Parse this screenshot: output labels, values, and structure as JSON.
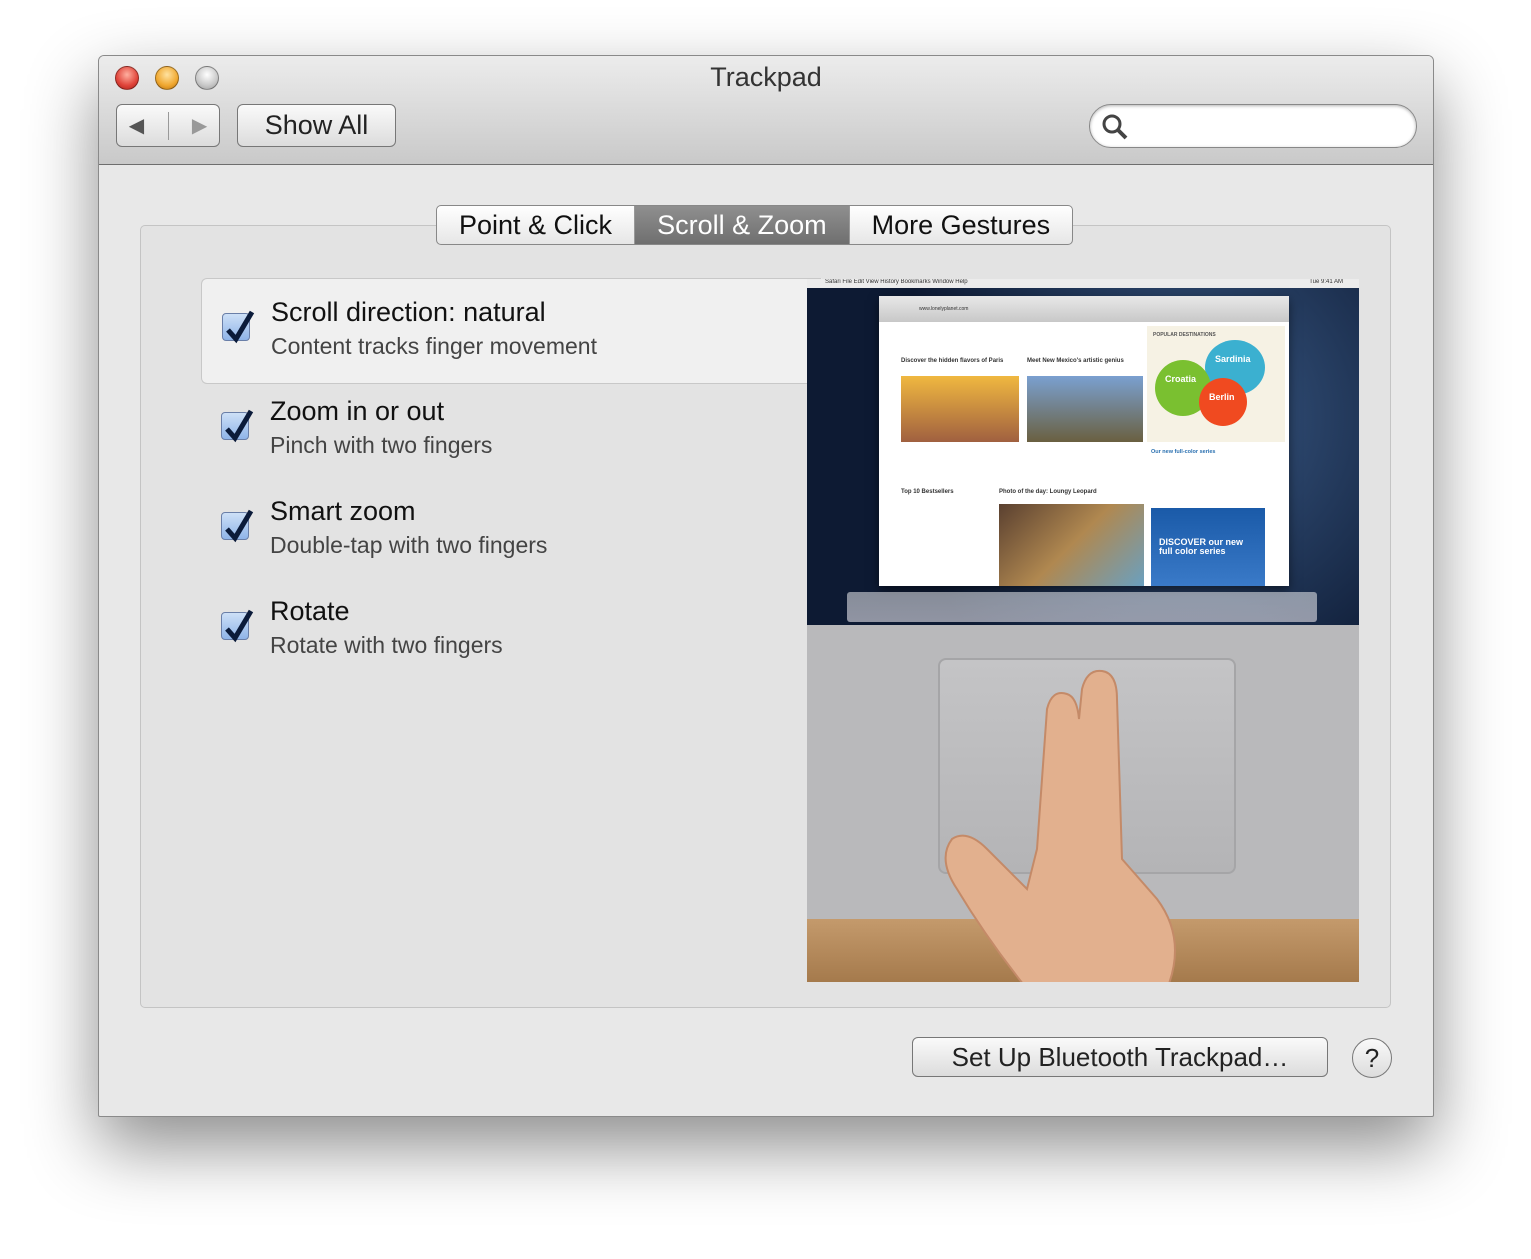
{
  "window": {
    "title": "Trackpad"
  },
  "toolbar": {
    "back": "◀",
    "forward": "▶",
    "show_all": "Show All",
    "search_placeholder": ""
  },
  "tabs": [
    {
      "label": "Point & Click"
    },
    {
      "label": "Scroll & Zoom",
      "selected": true
    },
    {
      "label": "More Gestures"
    }
  ],
  "options": [
    {
      "title": "Scroll direction: natural",
      "subtitle": "Content tracks finger movement",
      "checked": true
    },
    {
      "title": "Zoom in or out",
      "subtitle": "Pinch with two fingers",
      "checked": true
    },
    {
      "title": "Smart zoom",
      "subtitle": "Double-tap with two fingers",
      "checked": true
    },
    {
      "title": "Rotate",
      "subtitle": "Rotate with two fingers",
      "checked": true
    }
  ],
  "preview": {
    "menubar": "Safari   File   Edit   View   History   Bookmarks   Window   Help",
    "clock": "Tue 9:41 AM",
    "url": "www.lonelyplanet.com",
    "destinations_heading": "POPULAR DESTINATIONS",
    "sardinia": "Sardinia",
    "croatia": "Croatia",
    "berlin": "Berlin",
    "paris_heading": "Discover the hidden flavors of Paris",
    "nm_heading": "Meet New Mexico's artistic genius",
    "series": "Our new full-color series",
    "bestsellers": "Top 10 Bestsellers",
    "leopard": "Photo of the day: Loungy Leopard",
    "discover": "DISCOVER our new full color series"
  },
  "footer": {
    "setup_button": "Set Up Bluetooth Trackpad…",
    "help": "?"
  },
  "colors": {
    "selected_tab": "#7a7a7a",
    "close": "#e0443a",
    "minimize": "#f0a830"
  }
}
